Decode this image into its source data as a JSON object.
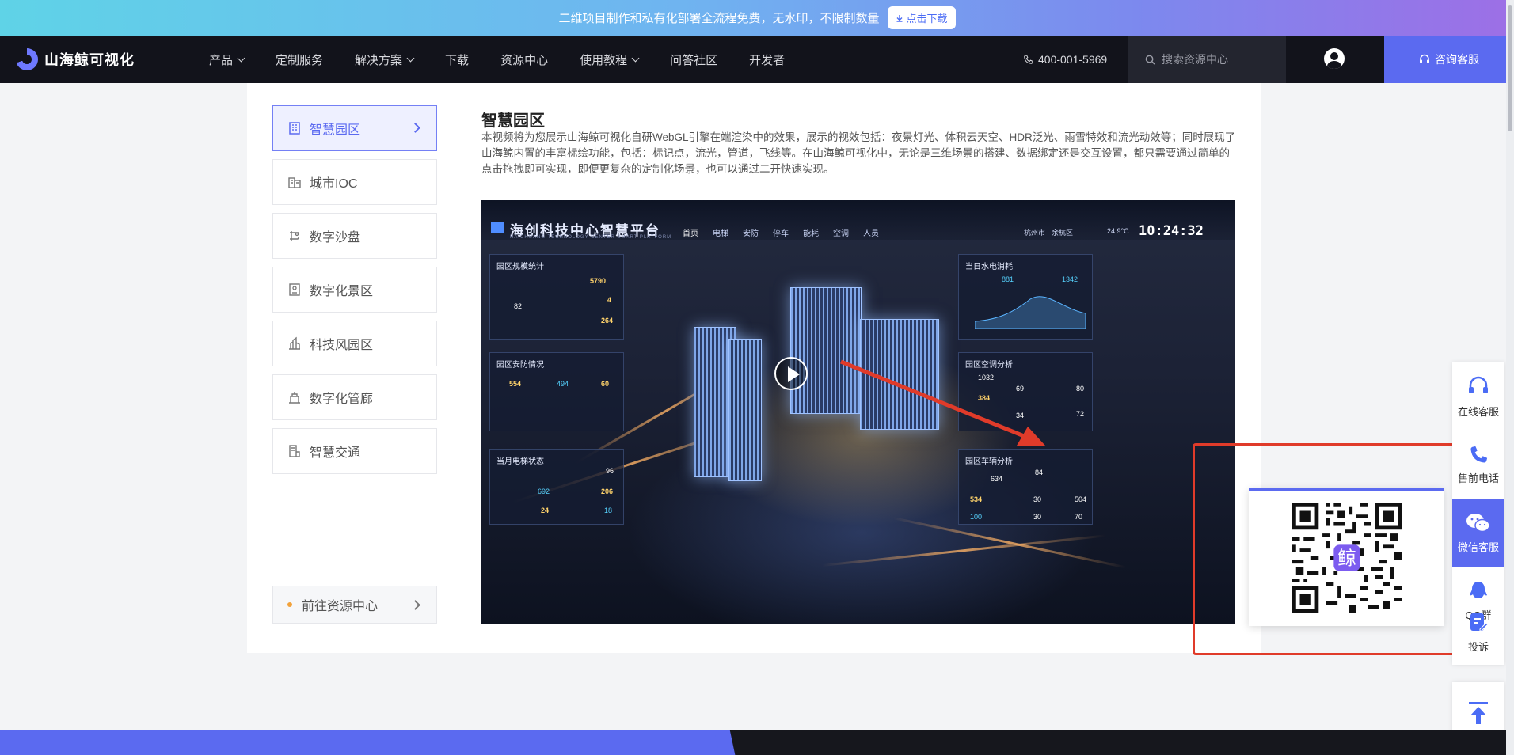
{
  "promo": {
    "text": "二维项目制作和私有化部署全流程免费，无水印，不限制数量",
    "button": "点击下载"
  },
  "nav": {
    "logo": "山海鲸可视化",
    "items": [
      {
        "label": "产品",
        "dropdown": true
      },
      {
        "label": "定制服务",
        "dropdown": false
      },
      {
        "label": "解决方案",
        "dropdown": true
      },
      {
        "label": "下载",
        "dropdown": false
      },
      {
        "label": "资源中心",
        "dropdown": false
      },
      {
        "label": "使用教程",
        "dropdown": true
      },
      {
        "label": "问答社区",
        "dropdown": false
      },
      {
        "label": "开发者",
        "dropdown": false
      }
    ],
    "phone": "400-001-5969",
    "search_placeholder": "搜索资源中心",
    "consult": "咨询客服"
  },
  "sidebar": {
    "items": [
      {
        "label": "智慧园区",
        "active": true
      },
      {
        "label": "城市IOC"
      },
      {
        "label": "数字沙盘"
      },
      {
        "label": "数字化景区"
      },
      {
        "label": "科技风园区"
      },
      {
        "label": "数字化管廊"
      },
      {
        "label": "智慧交通"
      }
    ],
    "goto": "前往资源中心"
  },
  "content": {
    "title": "智慧园区",
    "description": "本视频将为您展示山海鲸可视化自研WebGL引擎在端渲染中的效果，展示的视效包括：夜景灯光、体积云天空、HDR泛光、雨雪特效和流光动效等；同时展现了山海鲸内置的丰富标绘功能，包括：标记点，流光，管道，飞线等。在山海鲸可视化中，无论是三维场景的搭建、数据绑定还是交互设置，都只需要通过简单的点击拖拽即可实现，即便更复杂的定制化场景，也可以通过二开快速实现。"
  },
  "video": {
    "title": "海创科技中心智慧平台",
    "subtitle": "HAICHUANG TECHNOLOGY CENTER SMART PLATFORM",
    "menu": [
      "首页",
      "电梯",
      "安防",
      "停车",
      "能耗",
      "空调",
      "人员"
    ],
    "location": "杭州市 · 余杭区",
    "temperature": "24.9°C",
    "time": "10:24:32",
    "panels": {
      "park_stats": {
        "title": "园区规模统计",
        "area": "5790",
        "buildings": "4",
        "offices": "264",
        "ring": "82"
      },
      "security": {
        "title": "园区安防情况",
        "cameras": "554",
        "normal": "494",
        "abnormal": "60"
      },
      "elevator": {
        "title": "当月电梯状态",
        "safety": "96",
        "normal": "692",
        "abnormal": "206",
        "repairs": "24",
        "stops": "18"
      },
      "water_power": {
        "title": "当日水电消耗",
        "water": "881",
        "power": "1342"
      },
      "aircon": {
        "title": "园区空调分析",
        "total": "1032",
        "running": "384",
        "temp": "69",
        "humidity": "34",
        "devices": "80",
        "power": "72"
      },
      "parking": {
        "title": "园区车辆分析",
        "total": "634",
        "rate": "84",
        "used": "534",
        "free": "30",
        "spaces": "504",
        "sub1": "100",
        "sub2": "30",
        "sub3": "70"
      }
    }
  },
  "toolbar": {
    "items": [
      {
        "label": "在线客服",
        "icon": "headset-icon"
      },
      {
        "label": "售前电话",
        "icon": "phone-icon"
      },
      {
        "label": "微信客服",
        "icon": "wechat-icon",
        "active": true
      },
      {
        "label": "QQ群",
        "icon": "qq-icon"
      },
      {
        "label": "投诉",
        "icon": "complaint-icon"
      }
    ],
    "qr_center": "鲸"
  },
  "colors": {
    "accent": "#5b6af0",
    "nav_bg": "#12131b",
    "annotation": "#e03b2a"
  }
}
